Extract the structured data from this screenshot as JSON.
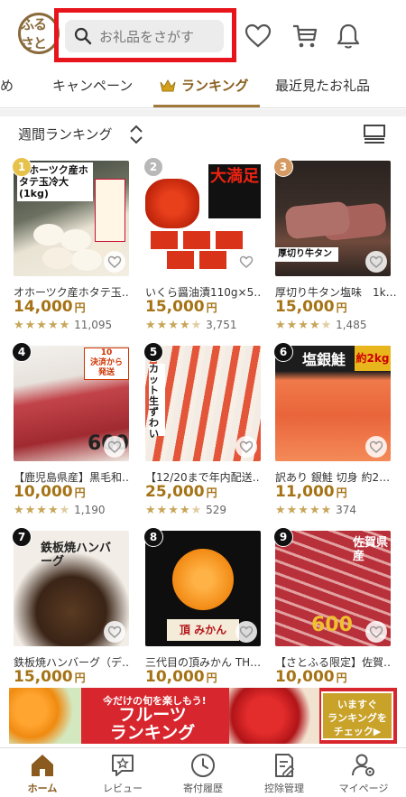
{
  "header": {
    "logo_text": "ふるさと",
    "search_placeholder": "お礼品をさがす"
  },
  "tabs": [
    {
      "label": "め"
    },
    {
      "label": "キャンペーン"
    },
    {
      "label": "ランキング",
      "active": true
    },
    {
      "label": "最近見たお礼品"
    }
  ],
  "ranking_bar": {
    "selected": "週間ランキング"
  },
  "items": [
    {
      "rank": "1",
      "title": "オホーツク産ホタテ玉…",
      "price": "14,000",
      "unit": "円",
      "stars": 5,
      "reviews": "11,095",
      "thumb_text": "オホーツク産ホタテ玉冷大(1kg)"
    },
    {
      "rank": "2",
      "title": "いくら醤油漬110g×5…",
      "price": "15,000",
      "unit": "円",
      "stars": 4.5,
      "reviews": "3,751",
      "thumb_text": "大満足"
    },
    {
      "rank": "3",
      "title": "厚切り牛タン塩味　1k…",
      "price": "15,000",
      "unit": "円",
      "stars": 4.5,
      "reviews": "1,485",
      "thumb_text": "厚切り牛タン"
    },
    {
      "rank": "4",
      "title": "【鹿児島県産】黒毛和…",
      "price": "10,000",
      "unit": "円",
      "stars": 4.5,
      "reviews": "1,190",
      "thumb_text": "600g"
    },
    {
      "rank": "5",
      "title": "【12/20まで年内配送…",
      "price": "25,000",
      "unit": "円",
      "stars": 4.5,
      "reviews": "529",
      "thumb_text": "カット生ずわい"
    },
    {
      "rank": "6",
      "title": "訳あり 銀鮭 切身 約2…",
      "price": "11,000",
      "unit": "円",
      "stars": 5,
      "reviews": "374",
      "thumb_text": "塩銀鮭"
    },
    {
      "rank": "7",
      "title": "鉄板焼ハンバーグ（デ…",
      "price": "15,000",
      "unit": "円",
      "thumb_text": "鉄板焼ハンバーグ"
    },
    {
      "rank": "8",
      "title": "三代目の頂みかん TH…",
      "price": "10,000",
      "unit": "円",
      "thumb_text": "頂 みかん"
    },
    {
      "rank": "9",
      "title": "【さとふる限定】佐賀…",
      "price": "10,000",
      "unit": "円",
      "thumb_text": "佐賀県産"
    }
  ],
  "banner": {
    "sub": "今だけの旬を楽しもう!",
    "main": "フルーツ\nランキング",
    "cta": "いますぐ\nランキングを\nチェック▶"
  },
  "bottom_nav": [
    {
      "label": "ホーム",
      "active": true
    },
    {
      "label": "レビュー"
    },
    {
      "label": "寄付履歴"
    },
    {
      "label": "控除管理"
    },
    {
      "label": "マイページ"
    }
  ],
  "colors": {
    "accent_gold": "#a57316",
    "search_highlight": "#e8141c",
    "banner_red": "#d8262e",
    "star": "#c8a659",
    "rank1": "#e7c24a",
    "rank2": "#b8b8b8",
    "rank3": "#d69a63",
    "rank_other": "#111111"
  }
}
